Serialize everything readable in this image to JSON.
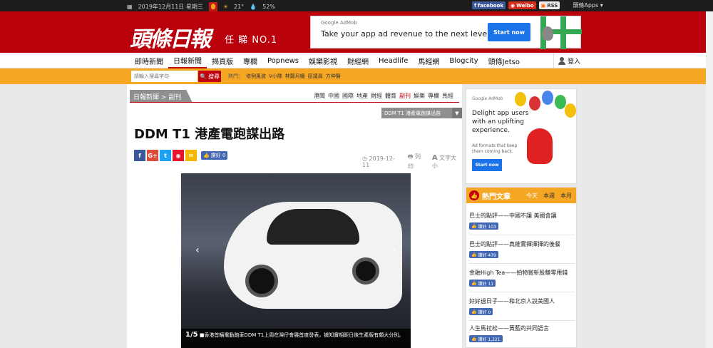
{
  "topbar": {
    "date": "2019年12月11日 星期三",
    "temp": "21°",
    "humidity": "52%",
    "facebook": "facebook",
    "weibo": "Weibo",
    "rss": "RSS",
    "apps": "頭條Apps"
  },
  "header": {
    "logo": "頭條日報",
    "slogan": "任 睇 NO.1"
  },
  "ad_top": {
    "brand": "Google AdMob",
    "text": "Take your app ad revenue to the next level.",
    "button": "Start now"
  },
  "nav": {
    "items": [
      "即時新聞",
      "日報新聞",
      "揭頁版",
      "專欄",
      "Popnews",
      "娛樂影視",
      "財經網",
      "Headlife",
      "馬經網",
      "Blogcity",
      "頭條Jetso"
    ],
    "login": "登入"
  },
  "search": {
    "placeholder": "請輸入搜尋字句",
    "button": "搜尋",
    "hot_label": "熱門：",
    "hot": [
      "修例風波",
      "V小隊",
      "林鄭月娥",
      "區議員",
      "方仲賢"
    ]
  },
  "article": {
    "breadcrumb": "日報新聞 > 副刊",
    "categories": [
      "港聞",
      "中國",
      "國際",
      "地產",
      "財經",
      "體育",
      "副刊",
      "娛樂",
      "專欄",
      "馬經"
    ],
    "dropdown": "DDM T1 港產電跑謀出路",
    "title": "DDM T1 港產電跑謀出路",
    "share_like": "讚好 0",
    "date": "2019-12-11",
    "print": "列印",
    "font": "文字大小",
    "photo_index": "1/5",
    "caption": "■香港首輛電動跑車DDM T1上周在灣仔會展首度發表，據知實相距日後生產版有頗大分別。"
  },
  "ad_side": {
    "brand": "Google AdMob",
    "text": "Delight app users with an uplifting experience.",
    "small": "Ad formats that keep them coming back.",
    "button": "Start now"
  },
  "hot_articles": {
    "title": "熱門文章",
    "tabs": [
      "今天",
      "本週",
      "本月"
    ],
    "items": [
      {
        "title": "巴士的點評——中國不讓 美國會讓",
        "likes": "讚好 103"
      },
      {
        "title": "巴士的點評——真維實揮揮揮的後餐",
        "likes": "讚好 479"
      },
      {
        "title": "金融High Tea——拍物嘗新股賺零用錢",
        "likes": "讚好 11"
      },
      {
        "title": "好好過日子——和北京人說美國人",
        "likes": "讚好 0"
      },
      {
        "title": "人生馬拉松——黃藍的共同語言",
        "likes": "讚好 1,221"
      }
    ]
  }
}
